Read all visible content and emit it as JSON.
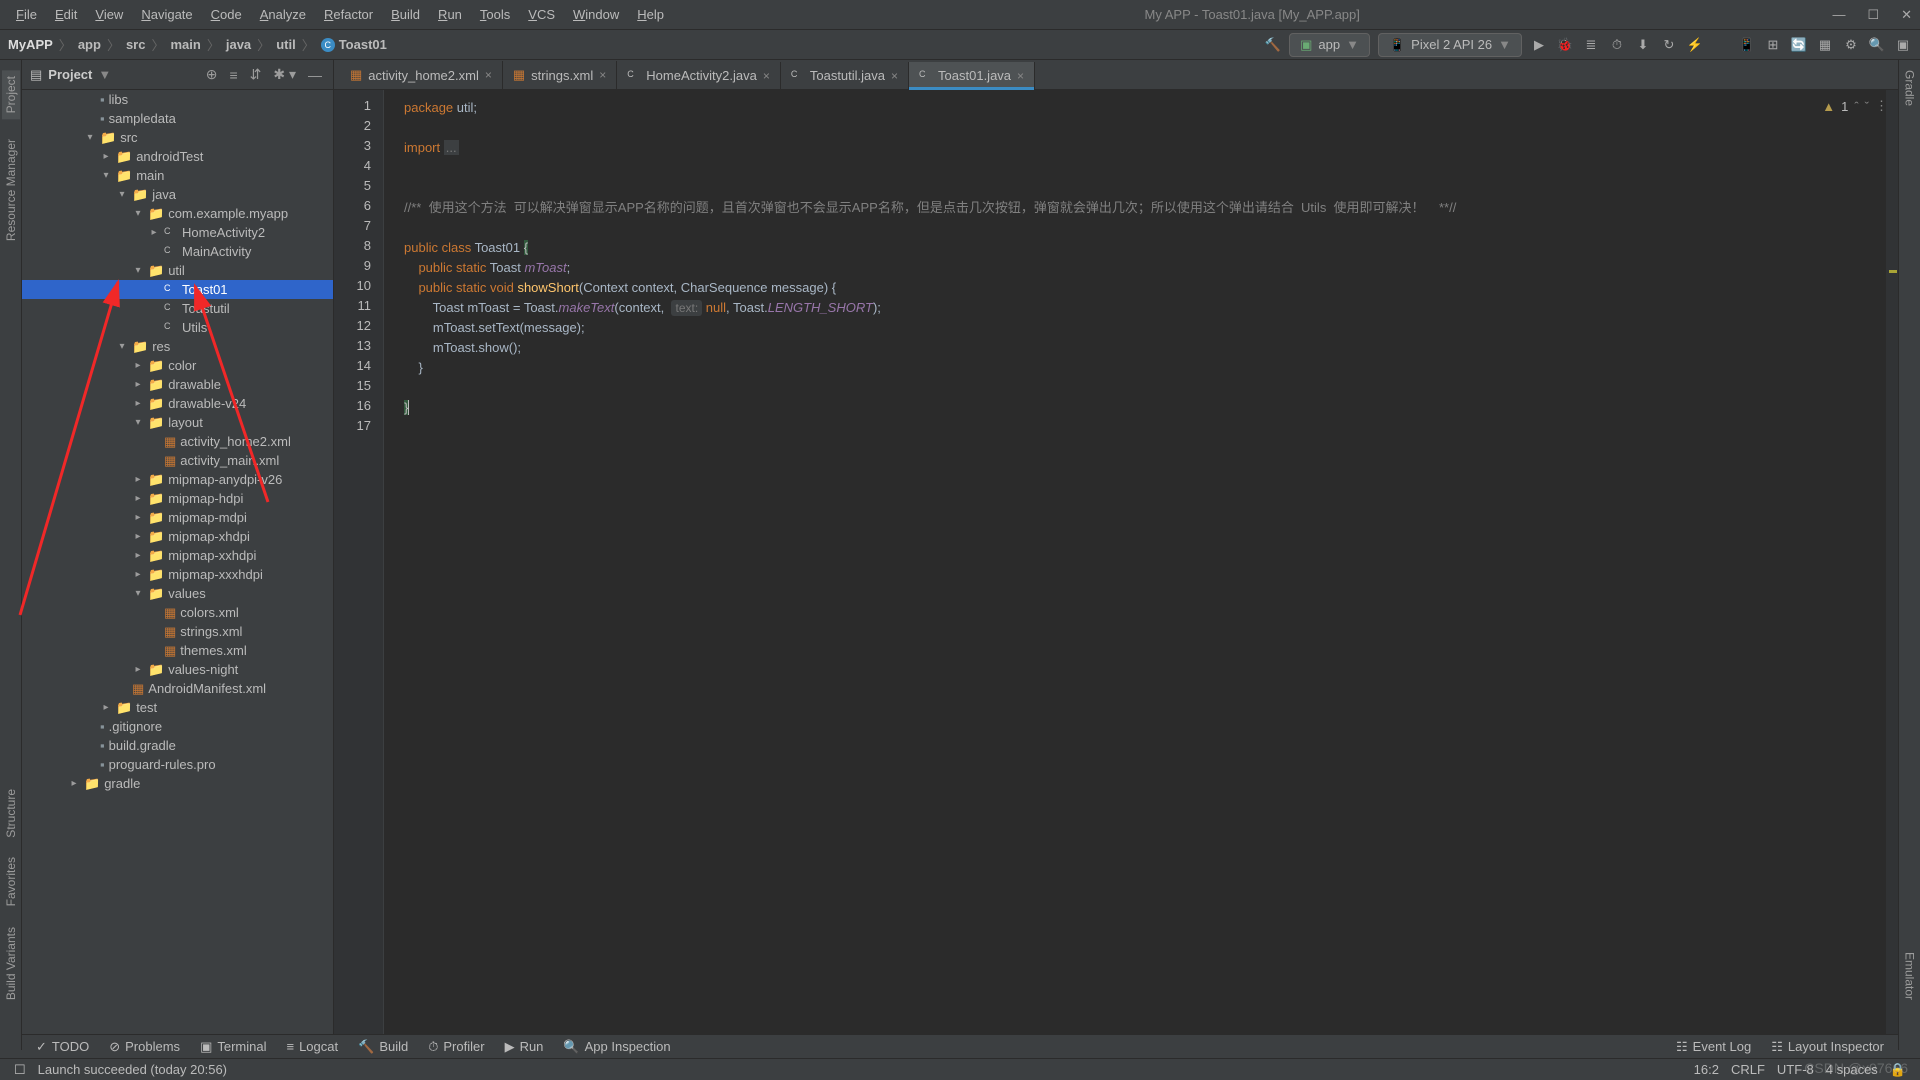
{
  "window": {
    "title": "My APP - Toast01.java [My_APP.app]"
  },
  "menus": [
    "File",
    "Edit",
    "View",
    "Navigate",
    "Code",
    "Analyze",
    "Refactor",
    "Build",
    "Run",
    "Tools",
    "VCS",
    "Window",
    "Help"
  ],
  "breadcrumbs": [
    "MyAPP",
    "app",
    "src",
    "main",
    "java",
    "util",
    "Toast01"
  ],
  "run": {
    "config": "app",
    "device": "Pixel 2 API 26"
  },
  "project": {
    "title": "Project"
  },
  "tree": [
    {
      "d": 3,
      "a": "",
      "i": "folg",
      "t": "libs"
    },
    {
      "d": 3,
      "a": "",
      "i": "folg",
      "t": "sampledata"
    },
    {
      "d": 3,
      "a": "▾",
      "i": "fold",
      "t": "src"
    },
    {
      "d": 4,
      "a": "▸",
      "i": "fold",
      "t": "androidTest"
    },
    {
      "d": 4,
      "a": "▾",
      "i": "fold",
      "t": "main"
    },
    {
      "d": 5,
      "a": "▾",
      "i": "fold",
      "t": "java"
    },
    {
      "d": 6,
      "a": "▾",
      "i": "fold",
      "t": "com.example.myapp"
    },
    {
      "d": 7,
      "a": "▸",
      "i": "cls",
      "t": "HomeActivity2"
    },
    {
      "d": 7,
      "a": "",
      "i": "cls",
      "t": "MainActivity"
    },
    {
      "d": 6,
      "a": "▾",
      "i": "fold",
      "t": "util"
    },
    {
      "d": 7,
      "a": "",
      "i": "cls",
      "t": "Toast01",
      "sel": true
    },
    {
      "d": 7,
      "a": "",
      "i": "cls",
      "t": "Toastutil"
    },
    {
      "d": 7,
      "a": "",
      "i": "cls",
      "t": "Utils"
    },
    {
      "d": 5,
      "a": "▾",
      "i": "fold",
      "t": "res"
    },
    {
      "d": 6,
      "a": "▸",
      "i": "fold",
      "t": "color"
    },
    {
      "d": 6,
      "a": "▸",
      "i": "fold",
      "t": "drawable"
    },
    {
      "d": 6,
      "a": "▸",
      "i": "fold",
      "t": "drawable-v24"
    },
    {
      "d": 6,
      "a": "▾",
      "i": "fold",
      "t": "layout"
    },
    {
      "d": 7,
      "a": "",
      "i": "xml",
      "t": "activity_home2.xml"
    },
    {
      "d": 7,
      "a": "",
      "i": "xml",
      "t": "activity_main.xml"
    },
    {
      "d": 6,
      "a": "▸",
      "i": "fold",
      "t": "mipmap-anydpi-v26"
    },
    {
      "d": 6,
      "a": "▸",
      "i": "fold",
      "t": "mipmap-hdpi"
    },
    {
      "d": 6,
      "a": "▸",
      "i": "fold",
      "t": "mipmap-mdpi"
    },
    {
      "d": 6,
      "a": "▸",
      "i": "fold",
      "t": "mipmap-xhdpi"
    },
    {
      "d": 6,
      "a": "▸",
      "i": "fold",
      "t": "mipmap-xxhdpi"
    },
    {
      "d": 6,
      "a": "▸",
      "i": "fold",
      "t": "mipmap-xxxhdpi"
    },
    {
      "d": 6,
      "a": "▾",
      "i": "fold",
      "t": "values"
    },
    {
      "d": 7,
      "a": "",
      "i": "xml",
      "t": "colors.xml"
    },
    {
      "d": 7,
      "a": "",
      "i": "xml",
      "t": "strings.xml"
    },
    {
      "d": 7,
      "a": "",
      "i": "xml",
      "t": "themes.xml"
    },
    {
      "d": 6,
      "a": "▸",
      "i": "fold",
      "t": "values-night"
    },
    {
      "d": 5,
      "a": "",
      "i": "xml",
      "t": "AndroidManifest.xml"
    },
    {
      "d": 4,
      "a": "▸",
      "i": "fold",
      "t": "test"
    },
    {
      "d": 3,
      "a": "",
      "i": "folg",
      "t": ".gitignore"
    },
    {
      "d": 3,
      "a": "",
      "i": "folg",
      "t": "build.gradle"
    },
    {
      "d": 3,
      "a": "",
      "i": "folg",
      "t": "proguard-rules.pro"
    },
    {
      "d": 2,
      "a": "▸",
      "i": "fold",
      "t": "gradle"
    }
  ],
  "tabs": [
    {
      "i": "xml",
      "t": "activity_home2.xml"
    },
    {
      "i": "xml",
      "t": "strings.xml"
    },
    {
      "i": "cls",
      "t": "HomeActivity2.java"
    },
    {
      "i": "cls",
      "t": "Toastutil.java"
    },
    {
      "i": "cls",
      "t": "Toast01.java",
      "active": true
    }
  ],
  "inspect": {
    "warnings": "1"
  },
  "code": {
    "lines": 17,
    "l1": {
      "kw": "package ",
      "id": "util",
      "sc": ";"
    },
    "l3": {
      "kw": "import ",
      "fold": "..."
    },
    "l6": "//**  使用这个方法  可以解决弹窗显示APP名称的问题，且首次弹窗也不会显示APP名称，但是点击几次按钮，弹窗就会弹出几次；所以使用这个弹出请结合  Utils  使用即可解决！    **//",
    "l8": {
      "a": "public class ",
      "b": "Toast01 ",
      "c": "{"
    },
    "l9": {
      "a": "    public static ",
      "b": "Toast ",
      "c": "mToast",
      "d": ";"
    },
    "l10": {
      "a": "    public static void ",
      "b": "showShort",
      "c": "(Context context, CharSequence message) {"
    },
    "l11": {
      "a": "        Toast mToast = Toast.",
      "b": "makeText",
      "c": "(context,  ",
      "hint": "text:",
      "d": " null",
      "e": ", Toast.",
      "f": "LENGTH_SHORT",
      "g": ");"
    },
    "l12": "        mToast.setText(message);",
    "l13": "        mToast.show();",
    "l14": "    }",
    "l16": "}"
  },
  "bottom_tools": [
    "TODO",
    "Problems",
    "Terminal",
    "Logcat",
    "Build",
    "Profiler",
    "Run",
    "App Inspection"
  ],
  "bottom_right": [
    "Event Log",
    "Layout Inspector"
  ],
  "left_tools": [
    "Project",
    "Resource Manager",
    "Structure",
    "Favorites",
    "Build Variants"
  ],
  "right_tools": [
    "Gradle",
    "Emulator"
  ],
  "status": {
    "msg": "Launch succeeded (today 20:56)",
    "pos": "16:2",
    "le": "CRLF",
    "enc": "UTF-8",
    "ind": "4 spaces"
  },
  "watermark": "CSDN @x97666"
}
